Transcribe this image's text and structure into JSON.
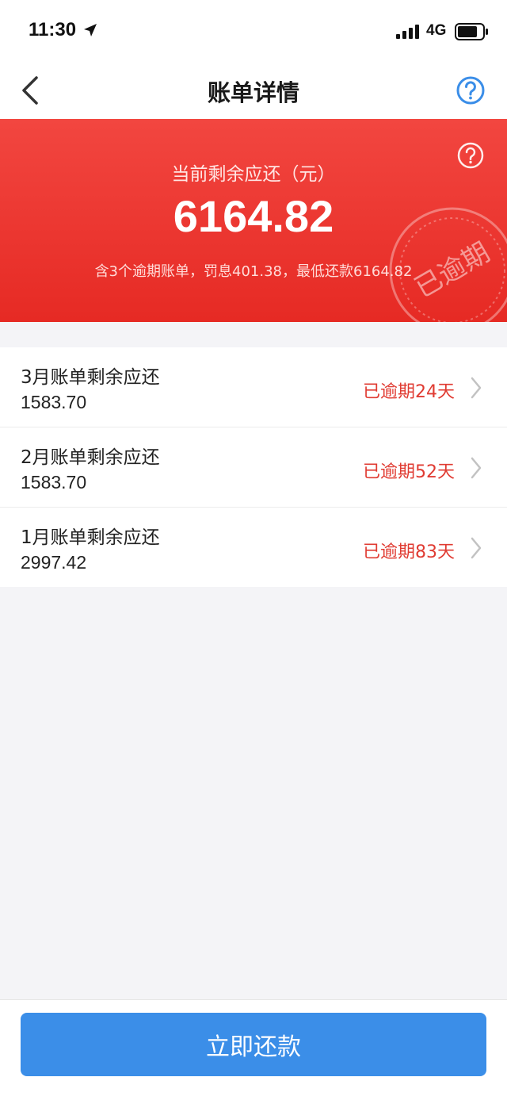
{
  "status_bar": {
    "time": "11:30",
    "network": "4G",
    "icons": [
      "location-arrow-icon",
      "signal-icon",
      "battery-icon"
    ]
  },
  "nav": {
    "title": "账单详情",
    "back_icon": "chevron-left-icon",
    "help_icon": "question-circle-icon"
  },
  "summary": {
    "label": "当前剩余应还（元）",
    "amount": "6164.82",
    "note": "含3个逾期账单，罚息401.38，最低还款6164.82",
    "stamp_text": "已逾期",
    "help_icon": "question-circle-icon"
  },
  "bills": [
    {
      "title": "3月账单剩余应还",
      "amount": "1583.70",
      "status": "已逾期24天"
    },
    {
      "title": "2月账单剩余应还",
      "amount": "1583.70",
      "status": "已逾期52天"
    },
    {
      "title": "1月账单剩余应还",
      "amount": "2997.42",
      "status": "已逾期83天"
    }
  ],
  "action": {
    "pay_label": "立即还款"
  },
  "colors": {
    "banner_red": "#e62a24",
    "overdue_red": "#e03b32",
    "accent_blue": "#3b8ee8"
  }
}
